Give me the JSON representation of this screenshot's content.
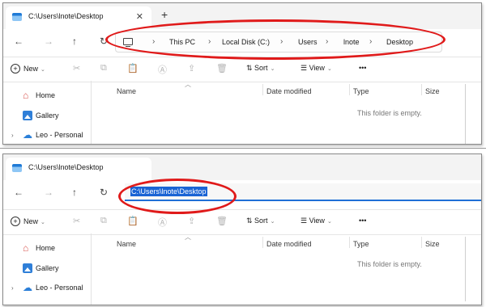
{
  "window": {
    "tab_title": "C:\\Users\\lnote\\Desktop",
    "close_glyph": "✕",
    "new_tab_glyph": "+"
  },
  "nav": {
    "back_glyph": "←",
    "forward_glyph": "→",
    "up_glyph": "↑",
    "refresh_glyph": "↻"
  },
  "breadcrumb": [
    "This PC",
    "Local Disk (C:)",
    "Users",
    "lnote",
    "Desktop"
  ],
  "breadcrumb_sep": "›",
  "address_text": "C:\\Users\\lnote\\Desktop",
  "toolbar": {
    "new_label": "New",
    "sort_label": "Sort",
    "view_label": "View",
    "more_label": "•••",
    "chevron": "⌄"
  },
  "sidebar": {
    "items": [
      {
        "label": "Home",
        "icon": "home-icon"
      },
      {
        "label": "Gallery",
        "icon": "gallery-icon"
      },
      {
        "label": "Leo - Personal",
        "icon": "cloud-icon"
      }
    ]
  },
  "columns": {
    "name": "Name",
    "date": "Date modified",
    "type": "Type",
    "size": "Size"
  },
  "empty_message": "This folder is empty.",
  "colors": {
    "highlight_ellipse": "#e01a1a",
    "selection": "#1a64d4",
    "accent_underline": "#1f6fd6"
  }
}
